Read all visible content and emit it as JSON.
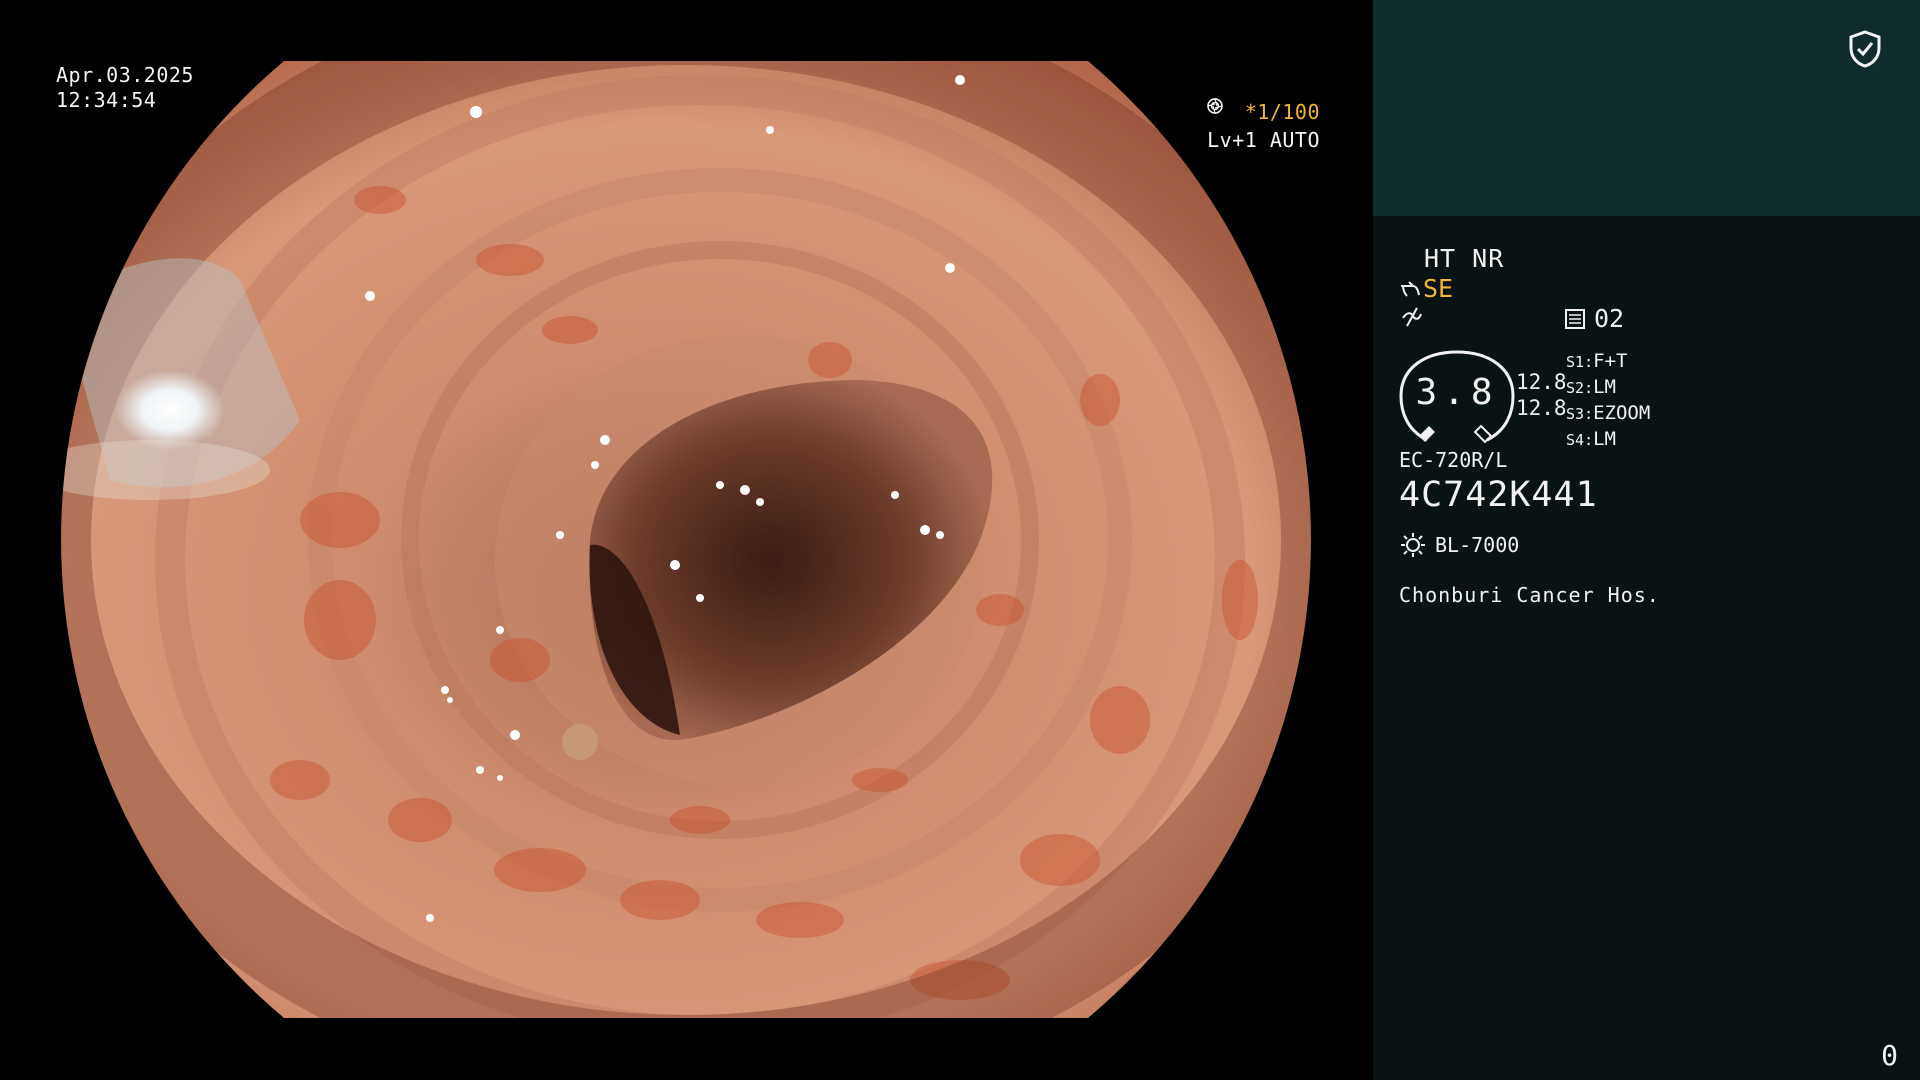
{
  "overlay": {
    "date": "Apr.03.2025",
    "time": "12:34:54",
    "shutter": "*1/100",
    "iris": "Lv+1 AUTO"
  },
  "panel": {
    "mode": "HT NR",
    "structure_enhance": "SE",
    "memory": "02",
    "dial_value": "3.8",
    "side_values": [
      "12.8",
      "12.8"
    ],
    "switches": [
      {
        "key": "S1",
        "value": "F+T"
      },
      {
        "key": "S2",
        "value": "LM"
      },
      {
        "key": "S3",
        "value": "EZOOM"
      },
      {
        "key": "S4",
        "value": "LM"
      }
    ],
    "scope_model": "EC-720R/L",
    "scope_serial": "4C742K441",
    "light_source": "BL-7000",
    "hospital": "Chonburi Cancer Hos.",
    "counter": "0"
  },
  "icons": [
    "shield-check-icon",
    "scope-tip-icon",
    "enhance-icon",
    "memory-icon",
    "lamp-icon",
    "aperture-icon"
  ],
  "colors": {
    "accent": "#f2b632",
    "panel_top": "#0f2b2b",
    "panel_bg": "#0a1313"
  }
}
